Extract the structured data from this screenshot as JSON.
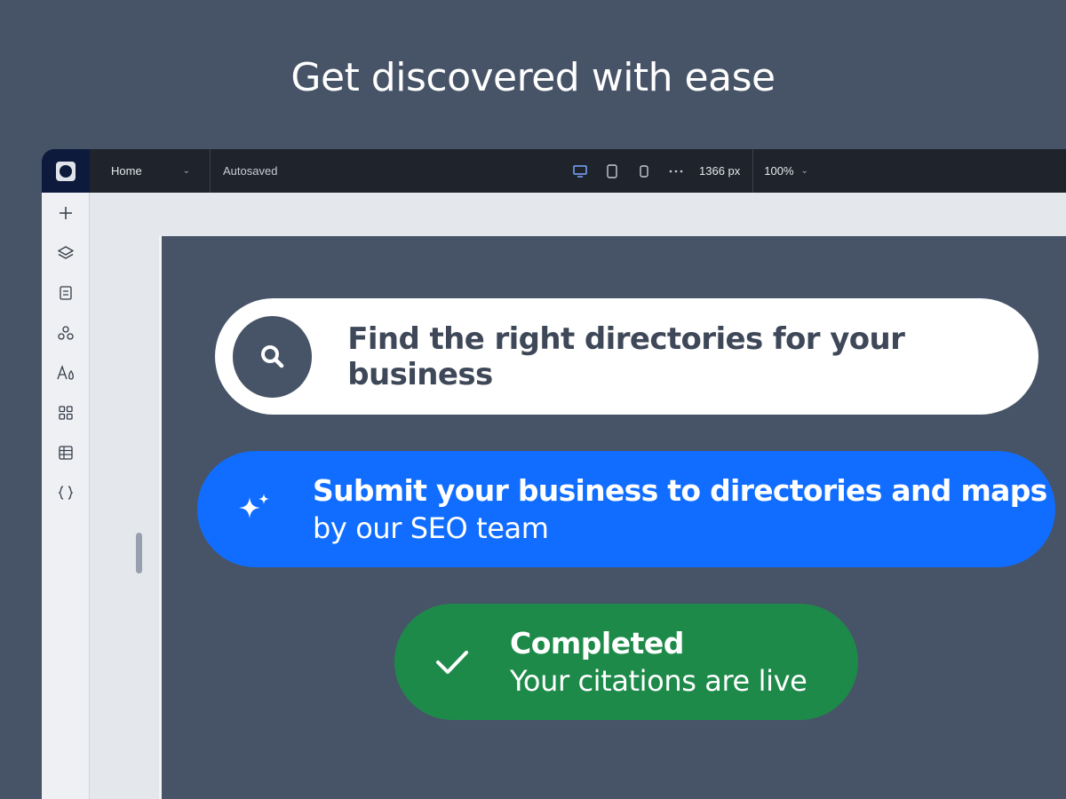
{
  "headline": "Get discovered with ease",
  "topbar": {
    "page_name": "Home",
    "autosave_status": "Autosaved",
    "viewport_width": "1366 px",
    "zoom": "100%",
    "devices": [
      "desktop-icon",
      "tablet-icon",
      "mobile-icon",
      "more-icon"
    ]
  },
  "sidebar": {
    "tools": [
      "add-icon",
      "layers-icon",
      "pages-icon",
      "apps-icon",
      "design-icon",
      "widgets-icon",
      "table-icon",
      "code-icon"
    ]
  },
  "steps": {
    "find": {
      "label": "Find the right directories for your business",
      "icon": "search-icon"
    },
    "submit": {
      "title": "Submit your business to directories and maps",
      "subtitle": "by our SEO team",
      "icon": "sparkle-icon"
    },
    "done": {
      "title": "Completed",
      "subtitle": "Your citations are live",
      "icon": "check-icon"
    }
  },
  "colors": {
    "background": "#475467",
    "topbar": "#1f232b",
    "accent_blue": "#116dff",
    "success_green": "#1e8a4a"
  }
}
